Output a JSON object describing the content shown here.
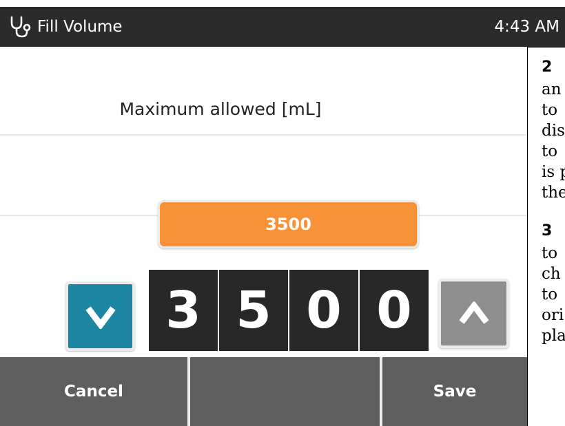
{
  "header": {
    "title": "Fill Volume",
    "time": "4:43 AM",
    "icon": "stethoscope-icon"
  },
  "main": {
    "label": "Maximum allowed [mL]",
    "max_value": "3500",
    "digits": [
      "3",
      "5",
      "0",
      "0"
    ],
    "down_icon": "chevron-down-icon",
    "up_icon": "chevron-up-icon"
  },
  "footer": {
    "cancel_label": "Cancel",
    "middle_label": "",
    "save_label": "Save"
  },
  "annotation": {
    "step2_number": "2",
    "step2_lines": [
      "an",
      "to",
      "dis",
      "to",
      "is p",
      "the"
    ],
    "step3_number": "3",
    "step3_lines": [
      "to",
      "ch",
      "to",
      "ori",
      "pla"
    ]
  },
  "colors": {
    "topbar": "#2b2b2b",
    "accent_orange": "#f79238",
    "down_button": "#1d86a2",
    "up_button_disabled": "#8e8e8e",
    "digit_bg": "#282828",
    "footer_bg": "#5e5e5e"
  }
}
